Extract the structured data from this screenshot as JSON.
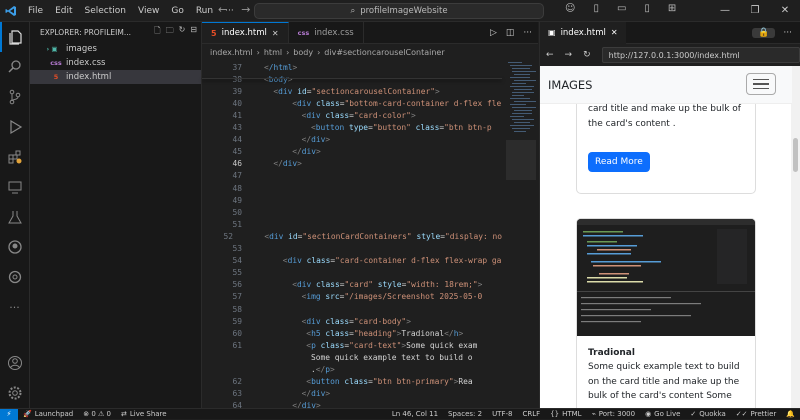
{
  "menu": [
    "File",
    "Edit",
    "Selection",
    "View",
    "Go",
    "Run",
    "···"
  ],
  "search": {
    "text": "profileImageWebsite"
  },
  "sidebar": {
    "title": "EXPLORER: PROFILEIM...",
    "items": [
      {
        "label": "images",
        "kind": "folder"
      },
      {
        "label": "index.css",
        "kind": "css"
      },
      {
        "label": "index.html",
        "kind": "html"
      }
    ]
  },
  "editor": {
    "tabs": [
      {
        "label": "index.html",
        "active": true
      },
      {
        "label": "index.css",
        "active": false
      }
    ],
    "breadcrumbs": [
      "index.html",
      "html",
      "body",
      "div#sectioncarouselContainer"
    ],
    "lines": [
      {
        "n": "37",
        "html": "<span class='p'>&lt;</span><span class='t'>/html</span><span class='p'>&gt;</span>",
        "indent": 0
      },
      {
        "n": "38",
        "html": "<span class='p'>&lt;</span><span class='t'>body</span><span class='p'>&gt;</span>",
        "indent": 0
      },
      {
        "n": "39",
        "html": "<span class='p'>&lt;</span><span class='t'>div</span> <span class='a'>id</span>=<span class='s'>\"sectioncarouselContainer\"</span><span class='p'>&gt;</span>",
        "indent": 2
      },
      {
        "n": "40",
        "html": "<span class='p'>&lt;</span><span class='t'>div</span> <span class='a'>class</span>=<span class='s'>\"bottom-card-container d-flex fle</span>",
        "indent": 6
      },
      {
        "n": "41",
        "html": "<span class='p'>&lt;</span><span class='t'>div</span> <span class='a'>class</span>=<span class='s'>\"card-color\"</span><span class='p'>&gt;</span>",
        "indent": 8
      },
      {
        "n": "43",
        "html": "<span class='p'>&lt;</span><span class='t'>button</span> <span class='a'>type</span>=<span class='s'>\"button\"</span> <span class='a'>class</span>=<span class='s'>\"btn btn-p</span>",
        "indent": 10
      },
      {
        "n": "44",
        "html": "<span class='p'>&lt;/</span><span class='t'>div</span><span class='p'>&gt;</span>",
        "indent": 8
      },
      {
        "n": "45",
        "html": "<span class='p'>&lt;/</span><span class='t'>div</span><span class='p'>&gt;</span>",
        "indent": 6
      },
      {
        "n": "46",
        "html": "<span class='p'>&lt;/</span><span class='t'>div</span><span class='p'>&gt;</span>",
        "indent": 2,
        "current": true
      },
      {
        "n": "47",
        "html": "",
        "indent": 0
      },
      {
        "n": "48",
        "html": "",
        "indent": 0
      },
      {
        "n": "49",
        "html": "",
        "indent": 0
      },
      {
        "n": "50",
        "html": "",
        "indent": 0
      },
      {
        "n": "51",
        "html": "",
        "indent": 0
      },
      {
        "n": "52",
        "html": "<span class='p'>&lt;</span><span class='t'>div</span> <span class='a'>id</span>=<span class='s'>\"sectionCardContainers\"</span> <span class='a'>style</span>=<span class='s'>\"display: no</span>",
        "indent": 2
      },
      {
        "n": "53",
        "html": "",
        "indent": 0
      },
      {
        "n": "54",
        "html": "<span class='p'>&lt;</span><span class='t'>div</span> <span class='a'>class</span>=<span class='s'>\"card-container d-flex flex-wrap ga</span>",
        "indent": 4
      },
      {
        "n": "55",
        "html": "",
        "indent": 0
      },
      {
        "n": "56",
        "html": "<span class='p'>&lt;</span><span class='t'>div</span> <span class='a'>class</span>=<span class='s'>\"card\"</span> <span class='a'>style</span>=<span class='s'>\"width: 18rem;\"</span><span class='p'>&gt;</span>",
        "indent": 6
      },
      {
        "n": "57",
        "html": "<span class='p'>&lt;</span><span class='t'>img</span> <span class='a'>src</span>=<span class='s'>\"/images/Screenshot 2025-05-0</span>",
        "indent": 8
      },
      {
        "n": "58",
        "html": "",
        "indent": 0
      },
      {
        "n": "59",
        "html": "<span class='p'>&lt;</span><span class='t'>div</span> <span class='a'>class</span>=<span class='s'>\"card-body\"</span><span class='p'>&gt;</span>",
        "indent": 8
      },
      {
        "n": "60",
        "html": "<span class='p'>&lt;</span><span class='t'>h5</span> <span class='a'>class</span>=<span class='s'>\"heading\"</span><span class='p'>&gt;</span>Tradional<span class='p'>&lt;/</span><span class='t'>h</span><span class='p'>&gt;</span>",
        "indent": 9
      },
      {
        "n": "61",
        "html": "<span class='p'>&lt;</span><span class='t'>p</span> <span class='a'>class</span>=<span class='s'>\"card-text\"</span><span class='p'>&gt;</span>Some quick exam",
        "indent": 9
      },
      {
        "n": "",
        "html": "Some quick example text to build o",
        "indent": 10
      },
      {
        "n": "",
        "html": ".<span class='p'>&lt;/</span><span class='t'>p</span><span class='p'>&gt;</span>",
        "indent": 10
      },
      {
        "n": "62",
        "html": "<span class='p'>&lt;</span><span class='t'>button</span> <span class='a'>class</span>=<span class='s'>\"btn btn-primary\"</span><span class='p'>&gt;</span>Rea",
        "indent": 9
      },
      {
        "n": "63",
        "html": "<span class='p'>&lt;/</span><span class='t'>div</span><span class='p'>&gt;</span>",
        "indent": 8
      },
      {
        "n": "64",
        "html": "<span class='p'>&lt;/</span><span class='t'>div</span><span class='p'>&gt;</span>",
        "indent": 6
      }
    ]
  },
  "preview": {
    "tab": "index.html",
    "url": "http://127.0.0.1:3000/index.html",
    "brand": "IMAGES",
    "card1_text": "bulk of the card's content Some quick example text to build on the card title and make up the bulk of the card's content .",
    "card1_button": "Read More",
    "card2_title": "Tradional",
    "card2_text": "Some quick example text to build on the card title and make up the bulk of the card's content Some"
  },
  "status": {
    "remote": "⚡",
    "launchpad": "Launchpad",
    "problems": "⊗ 0  ⚠ 0",
    "liveshare": "Live Share",
    "position": "Ln 46, Col 11",
    "spaces": "Spaces: 2",
    "encoding": "UTF-8",
    "eol": "CRLF",
    "language": "HTML",
    "port": "Port: 3000",
    "golive": "Go Live",
    "quokka": "Quokka",
    "prettier": "Prettier"
  },
  "colors": {
    "accent": "#0078d4",
    "button": "#0d6efd"
  }
}
